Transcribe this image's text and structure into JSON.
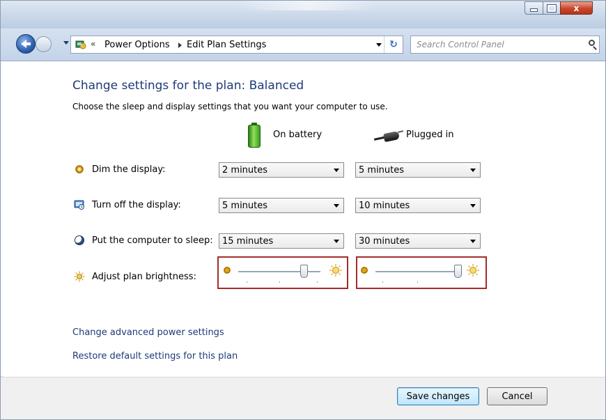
{
  "window": {
    "titlebar_buttons": [
      "minimize",
      "maximize",
      "close"
    ],
    "close_glyph": "x"
  },
  "nav": {
    "back_icon": "back-arrow-icon",
    "forward_icon": "forward-arrow-icon",
    "address": {
      "chevrons": "«",
      "crumbs": [
        "Power Options",
        "Edit Plan Settings"
      ]
    },
    "refresh_glyph": "↻",
    "search_placeholder": "Search Control Panel"
  },
  "main": {
    "title": "Change settings for the plan: Balanced",
    "subtitle": "Choose the sleep and display settings that you want your computer to use.",
    "columns": {
      "battery": "On battery",
      "plugged": "Plugged in"
    },
    "rows": [
      {
        "label": "Dim the display:",
        "icon": "dim-sun-icon",
        "battery": "2 minutes",
        "plugged": "5 minutes"
      },
      {
        "label": "Turn off the display:",
        "icon": "monitor-icon",
        "battery": "5 minutes",
        "plugged": "10 minutes"
      },
      {
        "label": "Put the computer to sleep:",
        "icon": "moon-icon",
        "battery": "15 minutes",
        "plugged": "30 minutes"
      }
    ],
    "brightness": {
      "label": "Adjust plan brightness:",
      "battery_level": 0.8,
      "plugged_level": 1.0
    },
    "links": {
      "advanced": "Change advanced power settings",
      "restore": "Restore default settings for this plan"
    }
  },
  "footer": {
    "save": "Save changes",
    "cancel": "Cancel"
  },
  "colors": {
    "title_blue": "#1e3a78",
    "highlight_red": "#a42b2b"
  }
}
